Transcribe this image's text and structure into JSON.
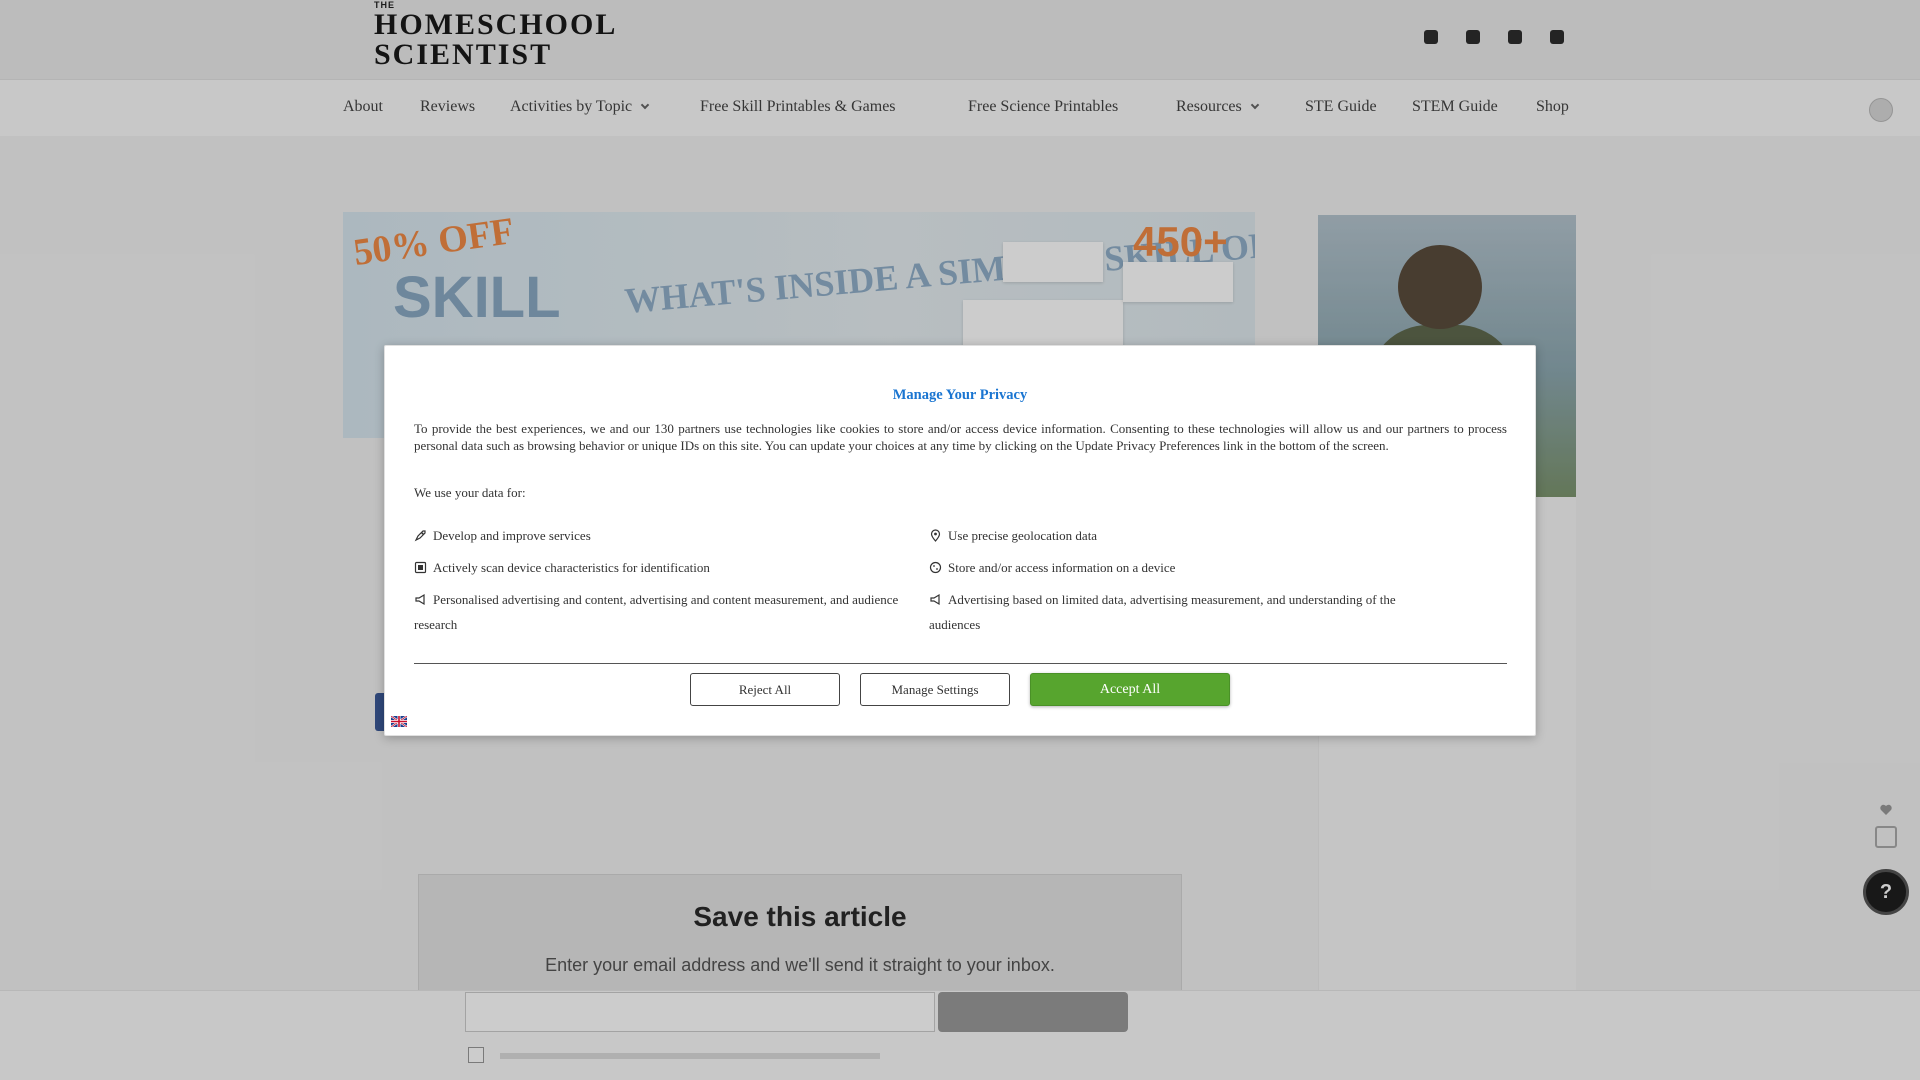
{
  "site": {
    "logo_small": "THE",
    "logo_line1": "HOMESCHOOL",
    "logo_line2": "SCIENTIST"
  },
  "nav": {
    "items": [
      {
        "label": "About",
        "has_dropdown": false
      },
      {
        "label": "Reviews",
        "has_dropdown": false
      },
      {
        "label": "Activities by Topic",
        "has_dropdown": true
      },
      {
        "label": "Free Skill Printables & Games",
        "has_dropdown": false
      },
      {
        "label": "Free Science Printables",
        "has_dropdown": false
      },
      {
        "label": "Resources",
        "has_dropdown": true
      },
      {
        "label": "STE Guide",
        "has_dropdown": false
      },
      {
        "label": "STEM Guide",
        "has_dropdown": false
      },
      {
        "label": "Shop",
        "has_dropdown": false
      }
    ]
  },
  "banner": {
    "discount": "50% OFF",
    "skill": "SKILL",
    "headline": "WHAT'S INSIDE A SIMPLE \"SKILL OF THE WEEK\"",
    "count": "450+"
  },
  "article": {
    "save_title": "Save this article",
    "save_subtitle": "Enter your email address and we'll send it straight to your inbox."
  },
  "modal": {
    "title": "Manage Your Privacy",
    "description": "To provide the best experiences, we and our 130 partners use technologies like cookies to store and/or access device information. Consenting to these technologies will allow us and our partners to process personal data such as browsing behavior or unique IDs on this site. You can update your choices at any time by clicking on the Update Privacy Preferences link in the bottom of the screen.",
    "use_intro": "We use your data for:",
    "purposes_left": [
      {
        "icon": "rocket-icon",
        "text": "Develop and improve services"
      },
      {
        "icon": "scan-icon",
        "text": "Actively scan device characteristics for identification"
      },
      {
        "icon": "megaphone-icon",
        "text": "Personalised advertising and content, advertising and content measurement, and audience research"
      }
    ],
    "purposes_right": [
      {
        "icon": "location-pin-icon",
        "text": "Use precise geolocation data"
      },
      {
        "icon": "cookie-icon",
        "text": "Store and/or access information on a device"
      },
      {
        "icon": "megaphone-icon",
        "text": "Advertising based on limited data, advertising measurement, and understanding of the audiences"
      }
    ],
    "buttons": {
      "reject": "Reject All",
      "manage": "Manage Settings",
      "accept": "Accept All"
    },
    "accent_color": "#1a75d1",
    "accept_color": "#57a52e",
    "language_flag": "uk-flag-icon"
  }
}
